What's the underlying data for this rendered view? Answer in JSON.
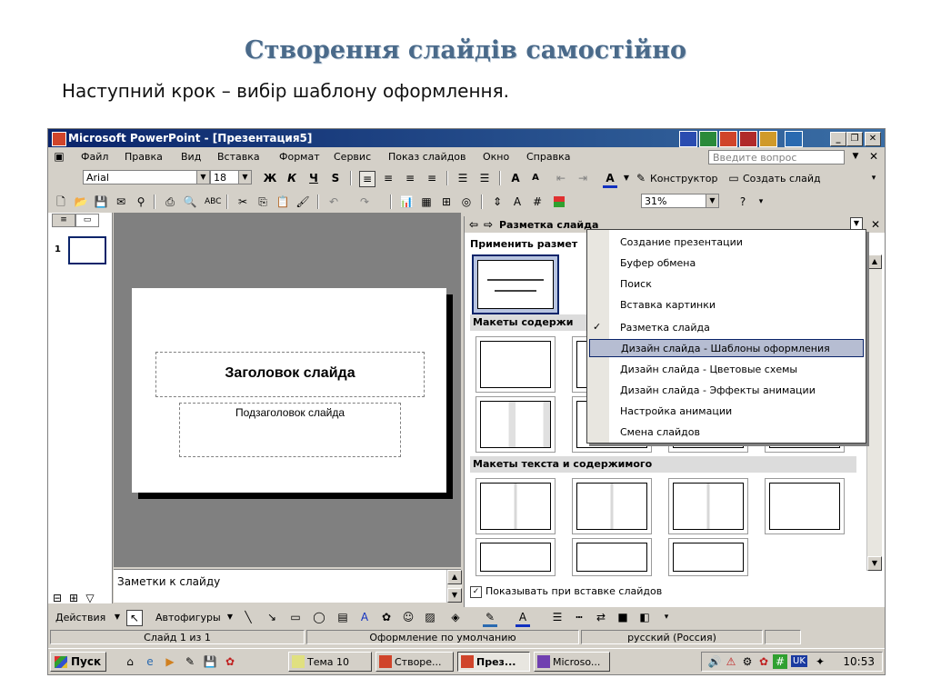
{
  "slide": {
    "title": "Створення слайдів самостійно",
    "subtitle": "Наступний крок – вибір шаблону оформлення."
  },
  "window": {
    "title": "Microsoft PowerPoint - [Презентация5]",
    "menu": [
      "Файл",
      "Правка",
      "Вид",
      "Вставка",
      "Формат",
      "Сервис",
      "Показ слайдов",
      "Окно",
      "Справка"
    ],
    "help_placeholder": "Введите вопрос"
  },
  "formatting": {
    "font": "Arial",
    "size": "18",
    "constructor_label": "Конструктор",
    "new_slide_label": "Создать слайд"
  },
  "standard": {
    "zoom": "31%"
  },
  "editor": {
    "slide_title_placeholder": "Заголовок слайда",
    "slide_subtitle_placeholder": "Подзаголовок слайда",
    "notes_placeholder": "Заметки к слайду",
    "thumb_number": "1"
  },
  "taskpane": {
    "title": "Разметка слайда",
    "apply_label": "Применить размет",
    "content_layouts": "Макеты содержи",
    "text_content_layouts": "Макеты текста и содержимого",
    "show_on_insert": "Показывать при вставке слайдов"
  },
  "dropdown": {
    "items": [
      "Создание презентации",
      "Буфер обмена",
      "Поиск",
      "Вставка картинки",
      "Разметка слайда",
      "Дизайн слайда - Шаблоны оформления",
      "Дизайн слайда - Цветовые схемы",
      "Дизайн слайда - Эффекты анимации",
      "Настройка анимации",
      "Смена слайдов"
    ],
    "checked_index": 4,
    "highlighted_index": 5
  },
  "drawing": {
    "actions_label": "Действия",
    "autoshapes_label": "Автофигуры"
  },
  "status": {
    "slide": "Слайд 1 из 1",
    "design": "Оформление по умолчанию",
    "language": "русский (Россия)"
  },
  "taskbar": {
    "start": "Пуск",
    "tasks": [
      "Тема 10",
      "Створе...",
      "През...",
      "Microso..."
    ],
    "lang": "UK",
    "clock": "10:53"
  },
  "colors": {
    "title_blue": "#4a6a8a",
    "titlebar_start": "#0a246a",
    "titlebar_end": "#3a6ea5",
    "highlight": "#b6bdd2"
  }
}
